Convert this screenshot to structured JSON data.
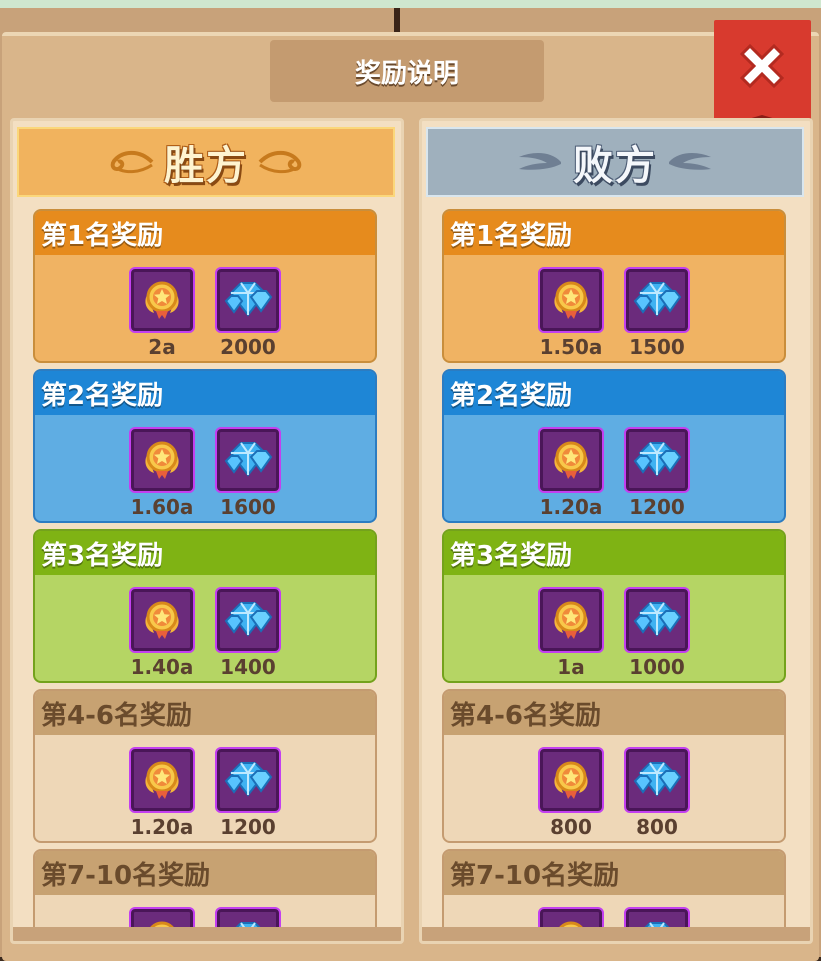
{
  "title": "奖励说明",
  "close_icon": "close-x-icon",
  "columns": [
    {
      "key": "win",
      "header": "胜方",
      "ranks": [
        {
          "label": "第1名奖励",
          "color": "orange",
          "items": [
            {
              "icon": "badge-icon",
              "qty": "2a"
            },
            {
              "icon": "diamond-icon",
              "qty": "2000"
            }
          ]
        },
        {
          "label": "第2名奖励",
          "color": "blue",
          "items": [
            {
              "icon": "badge-icon",
              "qty": "1.60a"
            },
            {
              "icon": "diamond-icon",
              "qty": "1600"
            }
          ]
        },
        {
          "label": "第3名奖励",
          "color": "green",
          "items": [
            {
              "icon": "badge-icon",
              "qty": "1.40a"
            },
            {
              "icon": "diamond-icon",
              "qty": "1400"
            }
          ]
        },
        {
          "label": "第4-6名奖励",
          "color": "beige",
          "items": [
            {
              "icon": "badge-icon",
              "qty": "1.20a"
            },
            {
              "icon": "diamond-icon",
              "qty": "1200"
            }
          ]
        },
        {
          "label": "第7-10名奖励",
          "color": "beige",
          "items": [
            {
              "icon": "badge-icon",
              "qty": ""
            },
            {
              "icon": "diamond-icon",
              "qty": ""
            }
          ]
        }
      ]
    },
    {
      "key": "lose",
      "header": "败方",
      "ranks": [
        {
          "label": "第1名奖励",
          "color": "orange",
          "items": [
            {
              "icon": "badge-icon",
              "qty": "1.50a"
            },
            {
              "icon": "diamond-icon",
              "qty": "1500"
            }
          ]
        },
        {
          "label": "第2名奖励",
          "color": "blue",
          "items": [
            {
              "icon": "badge-icon",
              "qty": "1.20a"
            },
            {
              "icon": "diamond-icon",
              "qty": "1200"
            }
          ]
        },
        {
          "label": "第3名奖励",
          "color": "green",
          "items": [
            {
              "icon": "badge-icon",
              "qty": "1a"
            },
            {
              "icon": "diamond-icon",
              "qty": "1000"
            }
          ]
        },
        {
          "label": "第4-6名奖励",
          "color": "beige",
          "items": [
            {
              "icon": "badge-icon",
              "qty": "800"
            },
            {
              "icon": "diamond-icon",
              "qty": "800"
            }
          ]
        },
        {
          "label": "第7-10名奖励",
          "color": "beige",
          "items": [
            {
              "icon": "badge-icon",
              "qty": ""
            },
            {
              "icon": "diamond-icon",
              "qty": ""
            }
          ]
        }
      ]
    }
  ]
}
